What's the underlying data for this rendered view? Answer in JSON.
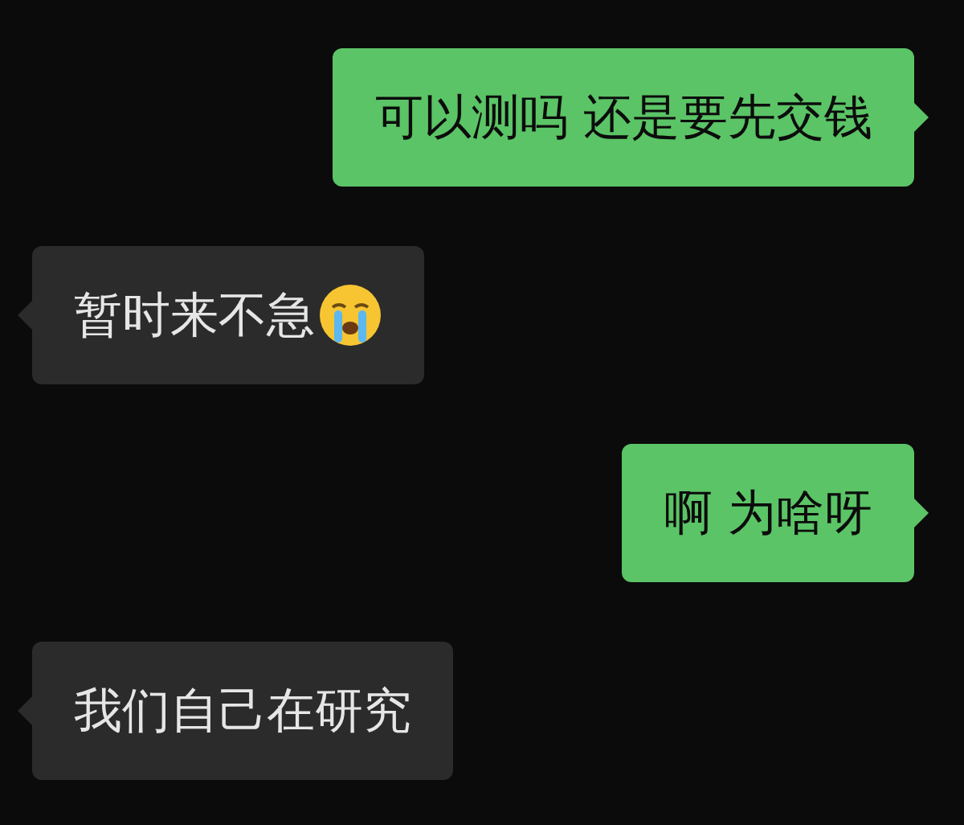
{
  "messages": [
    {
      "outgoing": true,
      "parts": [
        {
          "kind": "text",
          "text": "可以测吗 还是要先交钱"
        }
      ]
    },
    {
      "outgoing": false,
      "parts": [
        {
          "kind": "text",
          "text": "暂时来不急"
        },
        {
          "kind": "emoji"
        }
      ]
    },
    {
      "outgoing": true,
      "parts": [
        {
          "kind": "text",
          "text": "啊 为啥呀"
        }
      ]
    },
    {
      "outgoing": false,
      "parts": [
        {
          "kind": "text",
          "text": "我们自己在研究"
        }
      ]
    }
  ]
}
